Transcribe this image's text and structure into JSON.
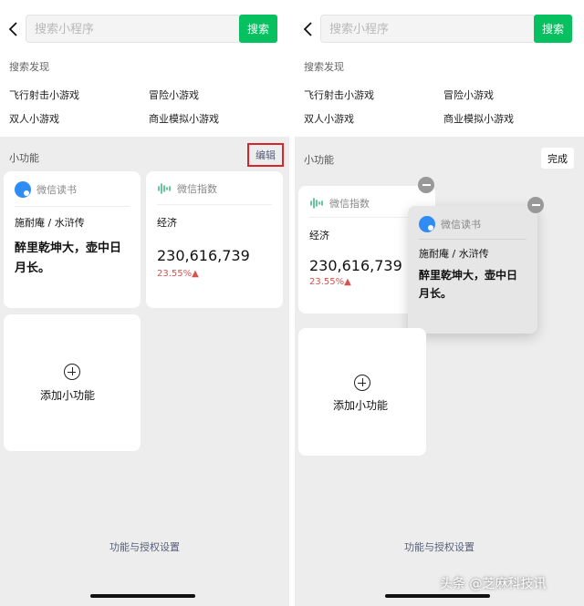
{
  "search": {
    "placeholder": "搜索小程序",
    "button": "搜索"
  },
  "discovery": {
    "title": "搜索发现",
    "items": [
      "飞行射击小游戏",
      "冒险小游戏",
      "双人小游戏",
      "商业模拟小游戏"
    ]
  },
  "widgets": {
    "section_title": "小功能",
    "edit_label": "编辑",
    "done_label": "完成",
    "book": {
      "title": "微信读书",
      "subtitle": "施耐庵 / 水浒传",
      "quote": "醉里乾坤大，壶中日月长。"
    },
    "index": {
      "title": "微信指数",
      "subtitle": "经济",
      "value": "230,616,739",
      "change": "23.55%"
    },
    "add_label": "添加小功能"
  },
  "footer": {
    "settings_link": "功能与授权设置"
  },
  "watermark": "头条 @芝麻科技讯",
  "colors": {
    "accent_green": "#07c160",
    "edit_highlight": "#d6262b",
    "link_blue_gray": "#56607a",
    "change_red": "#d6524f",
    "book_blue": "#2f8cf4"
  }
}
